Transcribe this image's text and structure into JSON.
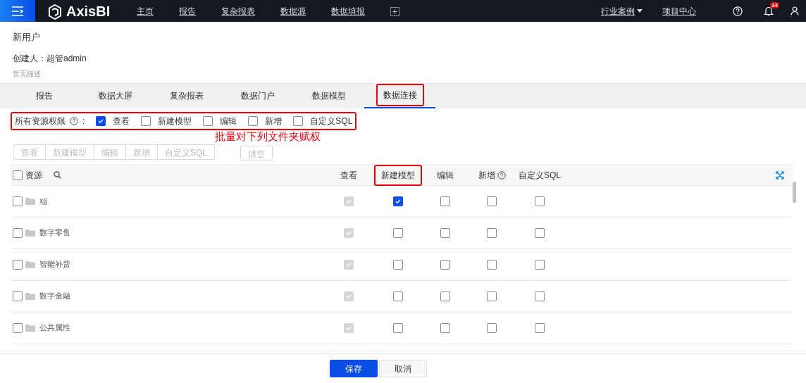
{
  "navbar": {
    "logo": "AxisBI",
    "items": [
      {
        "label": "主页"
      },
      {
        "label": "报告"
      },
      {
        "label": "复杂报表"
      },
      {
        "label": "数据源"
      },
      {
        "label": "数据填报"
      }
    ],
    "right_items": [
      {
        "label": "行业案例",
        "dropdown": true
      },
      {
        "label": "项目中心",
        "dropdown": false
      }
    ],
    "notification_count": "34"
  },
  "header": {
    "title": "新用户",
    "creator": "创建人：超管admin",
    "description": "暂无描述"
  },
  "tabs": [
    {
      "label": "报告",
      "selected": false,
      "highlighted": false
    },
    {
      "label": "数据大屏",
      "selected": false,
      "highlighted": false
    },
    {
      "label": "复杂报表",
      "selected": false,
      "highlighted": false
    },
    {
      "label": "数据门户",
      "selected": false,
      "highlighted": false
    },
    {
      "label": "数据模型",
      "selected": false,
      "highlighted": false
    },
    {
      "label": "数据连接",
      "selected": true,
      "highlighted": true
    }
  ],
  "bulk_permissions": {
    "label": "所有资源权限",
    "separator": ":",
    "highlighted": true,
    "options": [
      {
        "label": "查看",
        "checked": true
      },
      {
        "label": "新建模型",
        "checked": false
      },
      {
        "label": "编辑",
        "checked": false
      },
      {
        "label": "新增",
        "checked": false
      },
      {
        "label": "自定义SQL",
        "checked": false
      }
    ]
  },
  "annotation": "批量对下列文件夹赋权",
  "batch_buttons": [
    {
      "label": "查看",
      "disabled": true
    },
    {
      "label": "新建模型",
      "disabled": true
    },
    {
      "label": "编辑",
      "disabled": true
    },
    {
      "label": "新增",
      "disabled": true
    },
    {
      "label": "自定义SQL",
      "disabled": true
    }
  ],
  "clear_button": {
    "label": "清空",
    "disabled": true
  },
  "table": {
    "select_all_checked": false,
    "resource_column": "资源",
    "columns": [
      {
        "label": "查看",
        "help": false,
        "highlighted": false
      },
      {
        "label": "新建模型",
        "help": false,
        "highlighted": true
      },
      {
        "label": "编辑",
        "help": false,
        "highlighted": false
      },
      {
        "label": "新增",
        "help": true,
        "highlighted": false
      },
      {
        "label": "自定义SQL",
        "help": false,
        "highlighted": false
      }
    ],
    "rows": [
      {
        "name": "xjj",
        "selected": false,
        "permissions": [
          {
            "checked": true,
            "disabled": true
          },
          {
            "checked": true,
            "disabled": false
          },
          {
            "checked": false,
            "disabled": false
          },
          {
            "checked": false,
            "disabled": false
          },
          {
            "checked": false,
            "disabled": false
          }
        ]
      },
      {
        "name": "数字零售",
        "selected": false,
        "permissions": [
          {
            "checked": true,
            "disabled": true
          },
          {
            "checked": false,
            "disabled": false
          },
          {
            "checked": false,
            "disabled": false
          },
          {
            "checked": false,
            "disabled": false
          },
          {
            "checked": false,
            "disabled": false
          }
        ]
      },
      {
        "name": "智能补货",
        "selected": false,
        "permissions": [
          {
            "checked": true,
            "disabled": true
          },
          {
            "checked": false,
            "disabled": false
          },
          {
            "checked": false,
            "disabled": false
          },
          {
            "checked": false,
            "disabled": false
          },
          {
            "checked": false,
            "disabled": false
          }
        ]
      },
      {
        "name": "数字金融",
        "selected": false,
        "permissions": [
          {
            "checked": true,
            "disabled": true
          },
          {
            "checked": false,
            "disabled": false
          },
          {
            "checked": false,
            "disabled": false
          },
          {
            "checked": false,
            "disabled": false
          },
          {
            "checked": false,
            "disabled": false
          }
        ]
      },
      {
        "name": "公共属性",
        "selected": false,
        "permissions": [
          {
            "checked": true,
            "disabled": true
          },
          {
            "checked": false,
            "disabled": false
          },
          {
            "checked": false,
            "disabled": false
          },
          {
            "checked": false,
            "disabled": false
          },
          {
            "checked": false,
            "disabled": false
          }
        ]
      }
    ]
  },
  "footer_buttons": [
    {
      "label": "保存",
      "kind": "primary"
    },
    {
      "label": "取消",
      "kind": "secondary"
    }
  ]
}
